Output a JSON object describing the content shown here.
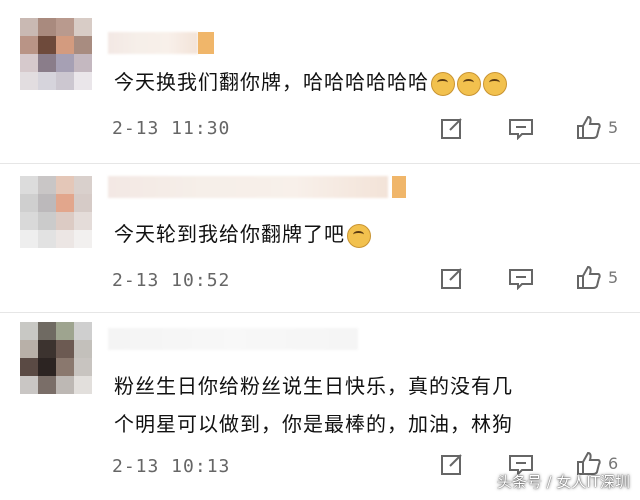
{
  "comments": [
    {
      "text": "今天换我们翻你牌，哈哈哈哈哈哈",
      "emoji_count": 3,
      "time": "2-13 11:30",
      "likes": "5",
      "avatar_colors": [
        "#c9b9b3",
        "#a98a7e",
        "#b99a8e",
        "#d8ccc6",
        "#b99486",
        "#6e4a3b",
        "#d39b7f",
        "#a88c80",
        "#d6c9cc",
        "#8a7d8a",
        "#a6a0b4",
        "#c4b8c0",
        "#e2dde0",
        "#d6d4dc",
        "#ccc7d0",
        "#eae6ea"
      ]
    },
    {
      "text": "今天轮到我给你翻牌了吧",
      "emoji_count": 1,
      "time": "2-13 10:52",
      "likes": "5",
      "avatar_colors": [
        "#dcdcdc",
        "#c9c6c6",
        "#e4c7b8",
        "#d9d0cc",
        "#cfcfcf",
        "#bcb9bb",
        "#e2a68c",
        "#d6cbc7",
        "#d9d9d9",
        "#cbcbcb",
        "#dccbc4",
        "#e4dcd9",
        "#eeeeee",
        "#e2e2e2",
        "#ece6e4",
        "#f2f0ef"
      ]
    },
    {
      "text_line1": "粉丝生日你给粉丝说生日快乐，真的没有几",
      "text_line2": "个明星可以做到，你是最棒的，加油，林狗",
      "time": "2-13 10:13",
      "likes": "6",
      "avatar_colors": [
        "#c8c8c4",
        "#6f6a62",
        "#9ea48f",
        "#cfcfcf",
        "#b8b0a8",
        "#3c332f",
        "#6c5a52",
        "#c3c0bb",
        "#5a4a44",
        "#2c2422",
        "#8a786e",
        "#c8c4c0",
        "#c9c6c4",
        "#7a6e68",
        "#bdb8b4",
        "#e2dfdc"
      ]
    }
  ],
  "watermark": "头条号 / 女人IT深圳",
  "colors": {
    "icon": "#666666",
    "divider": "#e6e6e6"
  },
  "icons": [
    "edit-icon",
    "comment-icon",
    "like-icon"
  ]
}
